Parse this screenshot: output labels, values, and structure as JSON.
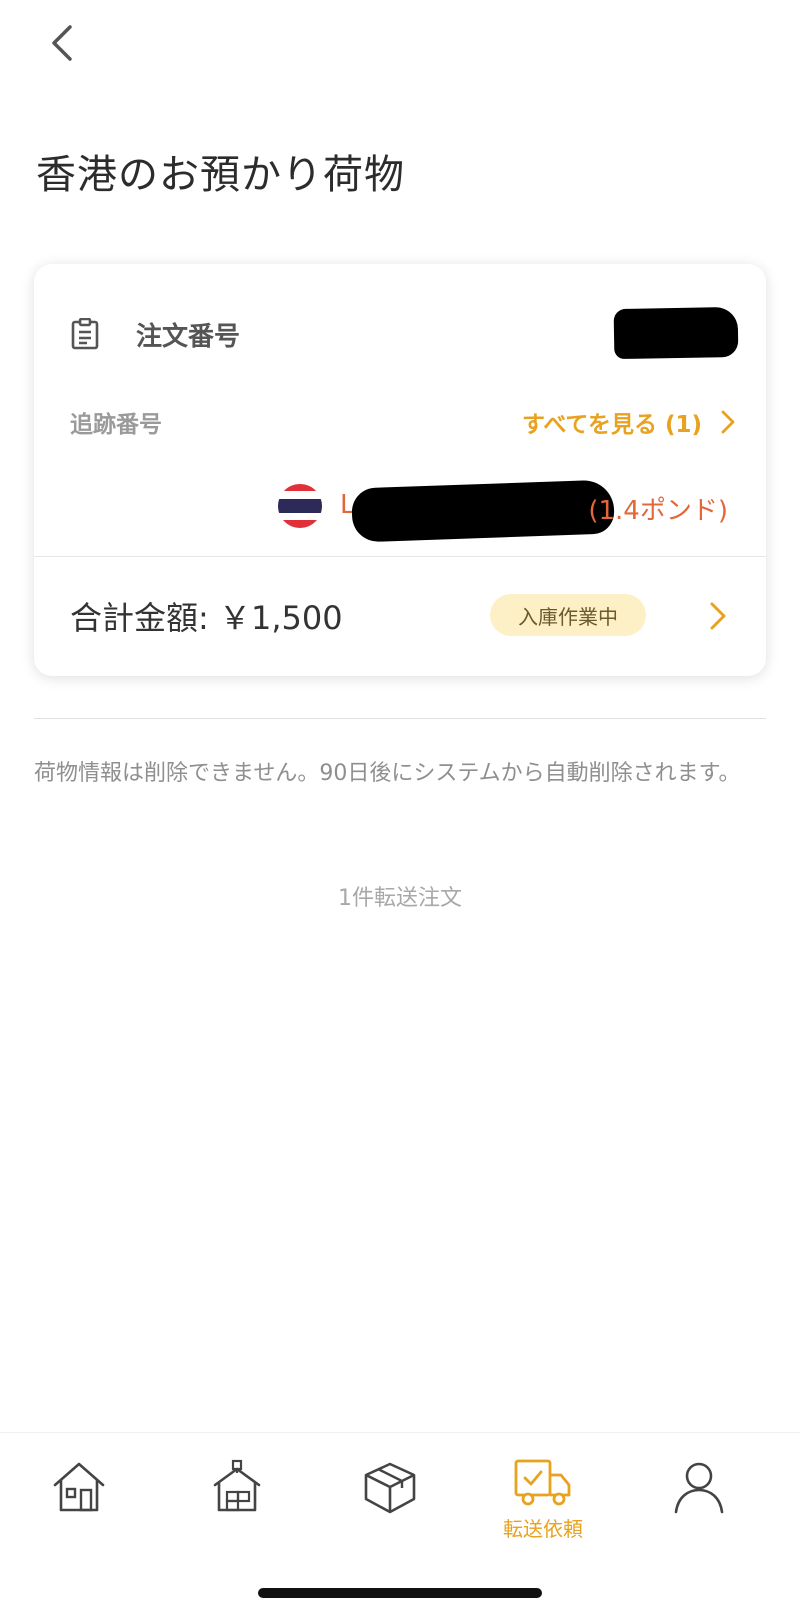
{
  "header": {
    "title": "香港のお預かり荷物"
  },
  "card": {
    "order_label": "注文番号",
    "tracking_label": "追跡番号",
    "see_all": "すべてを見る (1)",
    "package": {
      "prefix": "L",
      "weight": "(1.4ポンド)"
    },
    "total": "合計金額: ￥1,500",
    "status": "入庫作業中"
  },
  "notice": "荷物情報は削除できません。90日後にシステムから自動削除されます。",
  "order_count": "1件転送注文",
  "tabbar": {
    "active_tab_label": "転送依頼"
  },
  "colors": {
    "accent": "#e8a21f",
    "package_text": "#e2683a",
    "badge_bg": "#fdf0c6"
  }
}
